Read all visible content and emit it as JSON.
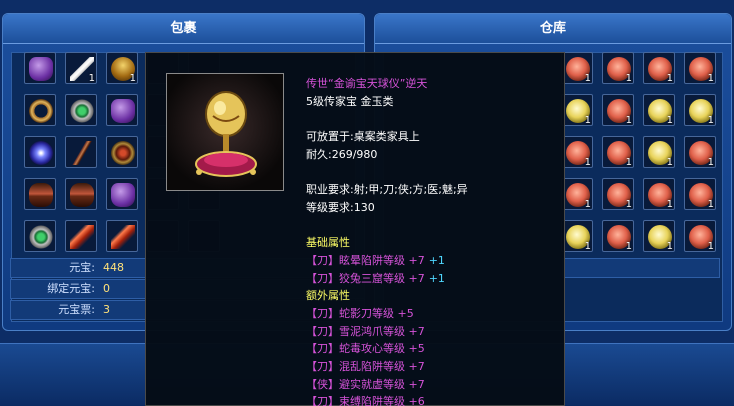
{
  "bag": {
    "title": "包裹",
    "slots": [
      [
        {
          "icon": "boot-icon",
          "count": ""
        },
        {
          "icon": "stick-icon",
          "count": "1"
        },
        {
          "icon": "lamp-icon",
          "count": "1"
        },
        null,
        null
      ],
      [
        {
          "icon": "ring-icon",
          "count": ""
        },
        {
          "icon": "green-ring-icon",
          "count": ""
        },
        {
          "icon": "boot-icon",
          "count": ""
        },
        null,
        null
      ],
      [
        {
          "icon": "orb-icon",
          "count": ""
        },
        {
          "icon": "staff-icon",
          "count": ""
        },
        {
          "icon": "amulet-icon",
          "count": ""
        },
        null,
        null
      ],
      [
        {
          "icon": "belt-icon",
          "count": ""
        },
        {
          "icon": "belt-icon",
          "count": ""
        },
        {
          "icon": "boot-icon",
          "count": ""
        },
        null,
        null
      ],
      [
        {
          "icon": "green-ring-icon",
          "count": ""
        },
        {
          "icon": "feather-icon",
          "count": ""
        },
        {
          "icon": "feather-icon",
          "count": ""
        },
        null,
        null
      ]
    ],
    "currency": [
      {
        "label": "元宝:",
        "value": "448"
      },
      {
        "label": "绑定元宝:",
        "value": "0"
      },
      {
        "label": "元宝票:",
        "value": "3"
      }
    ]
  },
  "warehouse": {
    "title": "仓库",
    "slots": [
      [
        {
          "icon": "rose-icon",
          "count": "1"
        },
        {
          "icon": "rose-icon",
          "count": "1"
        },
        {
          "icon": "rose-icon",
          "count": "1"
        },
        {
          "icon": "rose-icon",
          "count": "1"
        }
      ],
      [
        {
          "icon": "yellow-rose-icon",
          "count": "1"
        },
        {
          "icon": "rose-icon",
          "count": "1"
        },
        {
          "icon": "yellow-rose-icon",
          "count": "1"
        },
        {
          "icon": "yellow-rose-icon",
          "count": "1"
        }
      ],
      [
        {
          "icon": "rose-icon",
          "count": "1"
        },
        {
          "icon": "rose-icon",
          "count": "1"
        },
        {
          "icon": "yellow-rose-icon",
          "count": "1"
        },
        {
          "icon": "rose-icon",
          "count": "1"
        }
      ],
      [
        {
          "icon": "rose-icon",
          "count": "1"
        },
        {
          "icon": "rose-icon",
          "count": "1"
        },
        {
          "icon": "rose-icon",
          "count": "1"
        },
        {
          "icon": "rose-icon",
          "count": "1"
        }
      ],
      [
        {
          "icon": "yellow-rose-icon",
          "count": "1"
        },
        {
          "icon": "rose-icon",
          "count": "1"
        },
        {
          "icon": "yellow-rose-icon",
          "count": "1"
        },
        {
          "icon": "rose-icon",
          "count": "1"
        }
      ]
    ]
  },
  "tooltip": {
    "item_icon": "golden-ball-treasure-icon",
    "name": "传世“金谕宝天球仪”逆天",
    "grade": "5级传家宝 金玉类",
    "placement": "可放置于:桌案类家具上",
    "durability": "耐久:269/980",
    "job_req": "职业要求:射;甲;刀;侠;方;医;魅;异",
    "level_req": "等级要求:130",
    "basic_header": "基础属性",
    "basic": [
      {
        "text": "【刀】眩晕陷阱等级 +7",
        "extra": "+1"
      },
      {
        "text": "【刀】狡兔三窟等级 +7",
        "extra": "+1"
      }
    ],
    "extra_header": "额外属性",
    "extra": [
      {
        "text": "【刀】蛇影刀等级 +5"
      },
      {
        "text": "【刀】雪泥鸿爪等级 +7"
      },
      {
        "text": "【刀】蛇毒攻心等级 +5"
      },
      {
        "text": "【刀】混乱陷阱等级 +7"
      },
      {
        "text": "【侠】避实就虚等级 +7"
      },
      {
        "text": "【刀】束缚陷阱等级 +6"
      }
    ],
    "colors": {
      "name": "#d653d9",
      "header": "#ffff66",
      "bonus": "#4fd8ff"
    }
  }
}
